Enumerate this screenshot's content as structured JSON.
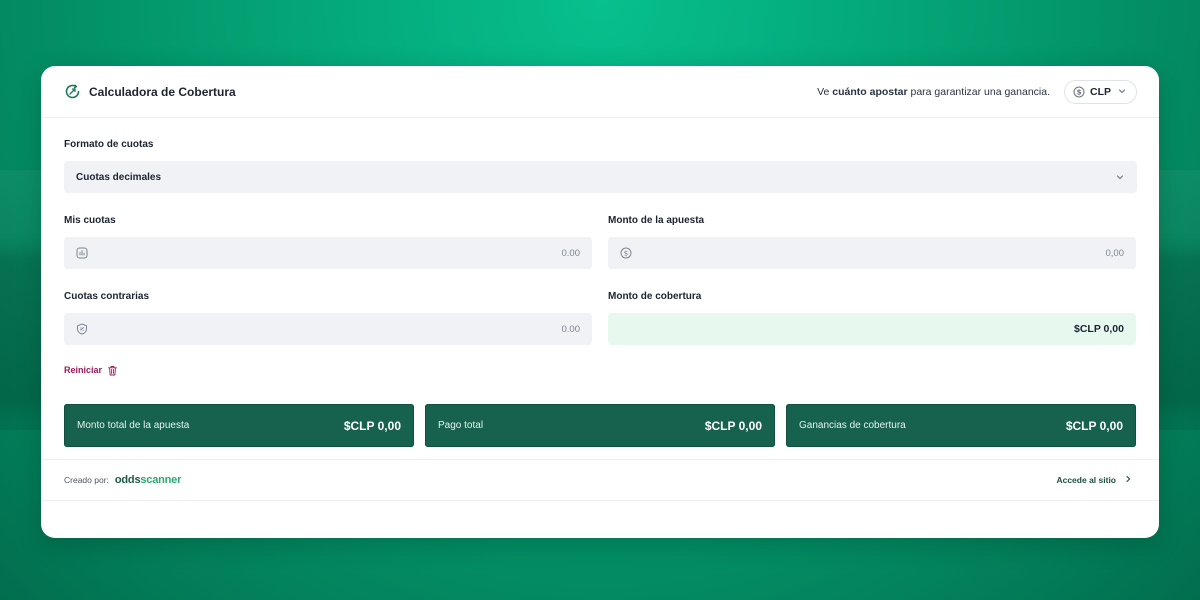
{
  "header": {
    "title": "Calculadora de Cobertura",
    "tagline_prefix": "Ve",
    "tagline_bold": "cuánto apostar",
    "tagline_suffix": "para garantizar una ganancia.",
    "currency": "CLP"
  },
  "form": {
    "odds_format": {
      "label": "Formato de cuotas",
      "value": "Cuotas decimales"
    },
    "my_odds": {
      "label": "Mis cuotas",
      "placeholder": "0.00"
    },
    "bet_amount": {
      "label": "Monto de la apuesta",
      "placeholder": "0,00"
    },
    "opposing_odds": {
      "label": "Cuotas contrarias",
      "placeholder": "0.00"
    },
    "hedge_amount": {
      "label": "Monto de cobertura",
      "value": "$CLP 0,00"
    },
    "reset_label": "Reiniciar"
  },
  "totals": [
    {
      "label": "Monto total de la apuesta",
      "value": "$CLP 0,00"
    },
    {
      "label": "Pago total",
      "value": "$CLP 0,00"
    },
    {
      "label": "Ganancias de cobertura",
      "value": "$CLP 0,00"
    }
  ],
  "footer": {
    "created_by": "Creado por:",
    "logo_left": "odds",
    "logo_right": "scanner",
    "site_link": "Accede al sitio"
  },
  "colors": {
    "brand_green": "#17624e",
    "accent_green": "#2ba76f",
    "reset_color": "#9c1a5a",
    "result_bg": "#e7f8ef"
  },
  "icons": [
    "hedge-calculator-icon",
    "coin-icon",
    "chevron-down-icon",
    "chart-icon",
    "dollar-circle-icon",
    "shield-icon",
    "trash-icon",
    "chevron-right-icon"
  ]
}
